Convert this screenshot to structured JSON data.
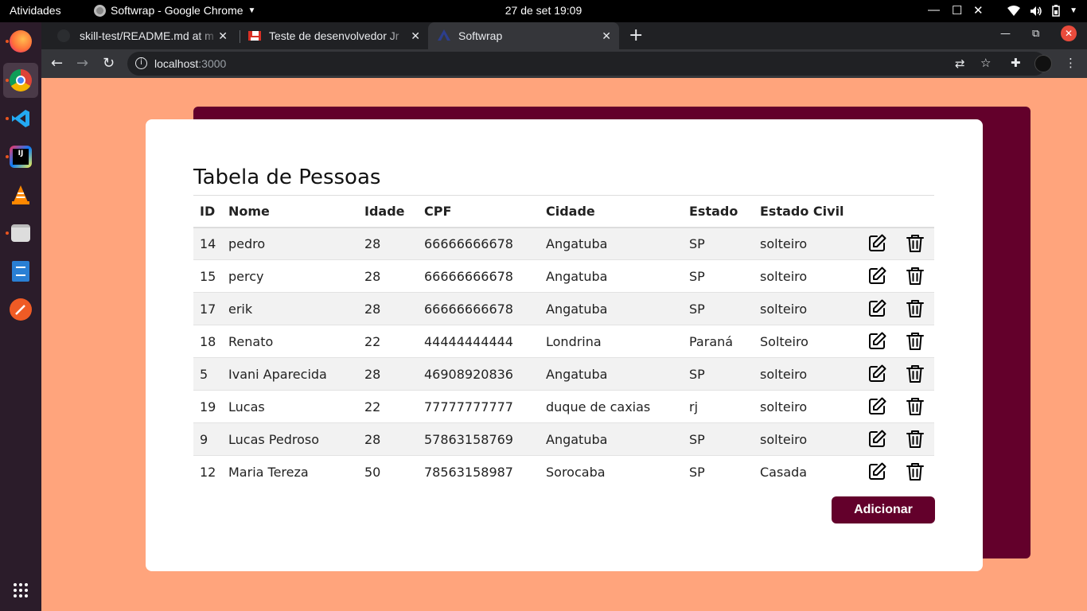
{
  "system": {
    "activities": "Atividades",
    "app_name": "Softwrap - Google Chrome",
    "clock": "27 de set  19:09"
  },
  "browser": {
    "tabs": [
      {
        "title": "skill-test/README.md at m",
        "active": false
      },
      {
        "title": "Teste de desenvolvedor Jr",
        "active": false
      },
      {
        "title": "Softwrap",
        "active": true
      }
    ],
    "url_host": "localhost",
    "url_port": ":3000"
  },
  "dock": [
    {
      "name": "firefox-icon"
    },
    {
      "name": "chrome-icon"
    },
    {
      "name": "vscode-icon"
    },
    {
      "name": "intellij-icon"
    },
    {
      "name": "vlc-icon"
    },
    {
      "name": "files-icon"
    },
    {
      "name": "text-editor-icon"
    },
    {
      "name": "postman-icon"
    },
    {
      "name": "app-grid-icon"
    }
  ],
  "page": {
    "title": "Tabela de Pessoas",
    "columns": [
      "ID",
      "Nome",
      "Idade",
      "CPF",
      "Cidade",
      "Estado",
      "Estado Civil"
    ],
    "rows": [
      [
        "14",
        "pedro",
        "28",
        "66666666678",
        "Angatuba",
        "SP",
        "solteiro"
      ],
      [
        "15",
        "percy",
        "28",
        "66666666678",
        "Angatuba",
        "SP",
        "solteiro"
      ],
      [
        "17",
        "erik",
        "28",
        "66666666678",
        "Angatuba",
        "SP",
        "solteiro"
      ],
      [
        "18",
        "Renato",
        "22",
        "44444444444",
        "Londrina",
        "Paraná",
        "Solteiro"
      ],
      [
        "5",
        "Ivani Aparecida",
        "28",
        "46908920836",
        "Angatuba",
        "SP",
        "solteiro"
      ],
      [
        "19",
        "Lucas",
        "22",
        "77777777777",
        "duque de caxias",
        "rj",
        "solteiro"
      ],
      [
        "9",
        "Lucas Pedroso",
        "28",
        "57863158769",
        "Angatuba",
        "SP",
        "solteiro"
      ],
      [
        "12",
        "Maria Tereza",
        "50",
        "78563158987",
        "Sorocaba",
        "SP",
        "Casada"
      ]
    ],
    "add_label": "Adicionar"
  },
  "colors": {
    "background": "#ffa47c",
    "accent": "#63002b"
  }
}
